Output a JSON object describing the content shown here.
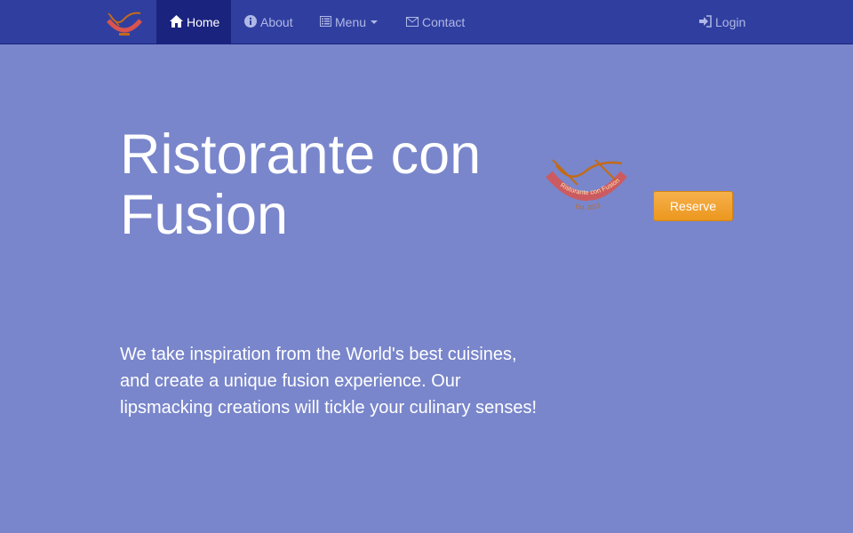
{
  "navbar": {
    "brand_logo": "restaurant-logo",
    "items": [
      {
        "label": "Home",
        "icon": "home-icon",
        "active": true
      },
      {
        "label": "About",
        "icon": "info-icon",
        "active": false
      },
      {
        "label": "Menu",
        "icon": "list-icon",
        "active": false
      },
      {
        "label": "Contact",
        "icon": "envelope-icon",
        "active": false
      }
    ],
    "login_label": "Login"
  },
  "jumbotron": {
    "title": "Ristorante con Fusion",
    "description": "We take inspiration from the World's best cuisines, and create a unique fusion experience. Our lipsmacking creations will tickle your culinary senses!",
    "logo_text": "Ristorante con Fusion",
    "logo_est": "Est. 2013",
    "reserve_label": "Reserve"
  },
  "colors": {
    "navbar_bg": "#303f9f",
    "navbar_active_bg": "#1a237e",
    "page_bg": "#7986cb",
    "reserve_bg": "#f0ad4e",
    "logo_red": "#d9534f",
    "logo_orange": "#c46a17"
  }
}
